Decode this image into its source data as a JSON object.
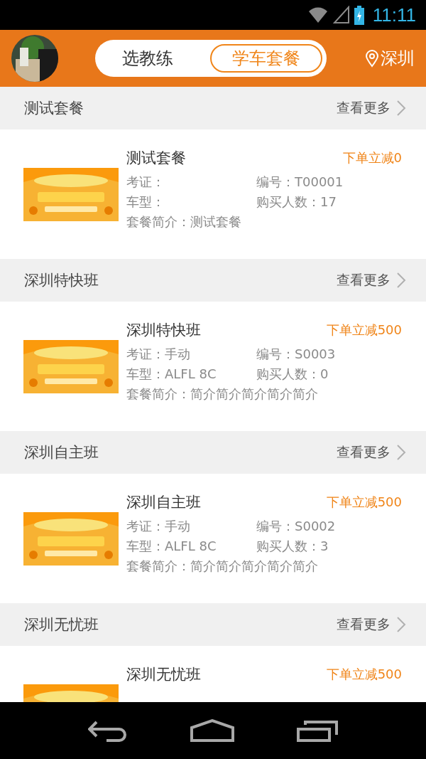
{
  "status_bar": {
    "time": "11:11"
  },
  "header": {
    "tabs": [
      {
        "label": "选教练",
        "selected": false
      },
      {
        "label": "学车套餐",
        "selected": true
      }
    ],
    "city": "深圳"
  },
  "sections": [
    {
      "title": "测试套餐",
      "more": "查看更多",
      "package": {
        "name": "测试套餐",
        "discount": "下单立减0",
        "license": "考证：",
        "number": "编号：T00001",
        "car_model": "车型：",
        "buyers": "购买人数：17",
        "intro": "套餐简介：测试套餐"
      }
    },
    {
      "title": "深圳特快班",
      "more": "查看更多",
      "package": {
        "name": "深圳特快班",
        "discount": "下单立减500",
        "license": "考证：手动",
        "number": "编号：S0003",
        "car_model": "车型：ALFL 8C",
        "buyers": "购买人数：0",
        "intro": "套餐简介：简介简介简介简介简介"
      }
    },
    {
      "title": "深圳自主班",
      "more": "查看更多",
      "package": {
        "name": "深圳自主班",
        "discount": "下单立减500",
        "license": "考证：手动",
        "number": "编号：S0002",
        "car_model": "车型：ALFL 8C",
        "buyers": "购买人数：3",
        "intro": "套餐简介：简介简介简介简介简介"
      }
    },
    {
      "title": "深圳无忧班",
      "more": "查看更多",
      "package": {
        "name": "深圳无忧班",
        "discount": "下单立减500"
      }
    }
  ]
}
